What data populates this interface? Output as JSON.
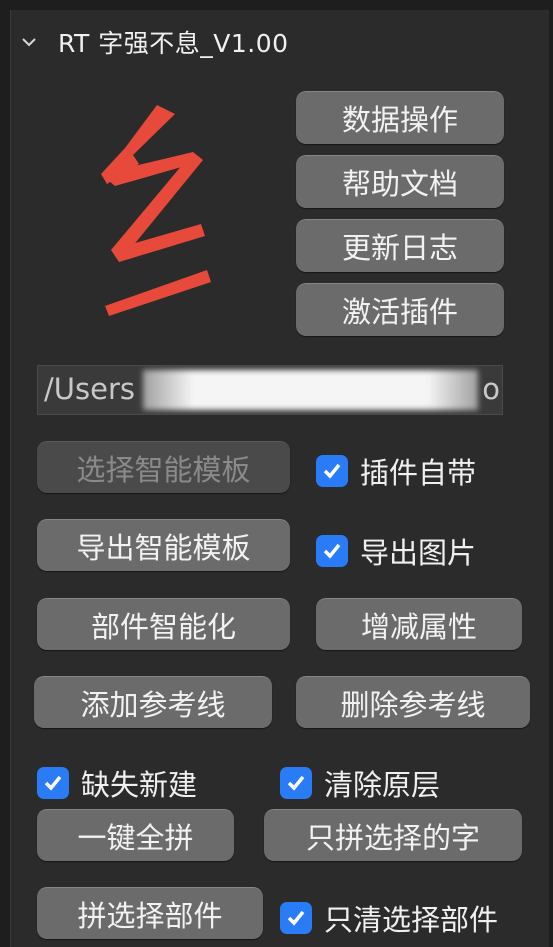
{
  "panel": {
    "title": "RT 字强不息_V1.00"
  },
  "logo": {
    "color": "#e7493b"
  },
  "side_buttons": [
    "数据操作",
    "帮助文档",
    "更新日志",
    "激活插件"
  ],
  "path_field": {
    "prefix": "/Users",
    "suffix": "o"
  },
  "buttons": {
    "select_template": "选择智能模板",
    "export_template": "导出智能模板",
    "componentize": "部件智能化",
    "edit_attributes": "增减属性",
    "add_guides": "添加参考线",
    "delete_guides": "删除参考线",
    "one_click_assemble": "一键全拼",
    "assemble_selected_chars": "只拼选择的字",
    "assemble_selected_parts": "拼选择部件"
  },
  "checkboxes": {
    "plugin_builtin": {
      "label": "插件自带",
      "checked": true
    },
    "export_images": {
      "label": "导出图片",
      "checked": true
    },
    "create_missing": {
      "label": "缺失新建",
      "checked": true
    },
    "clear_original_layer": {
      "label": "清除原层",
      "checked": true
    },
    "clear_selected_parts_only": {
      "label": "只清选择部件",
      "checked": true
    }
  },
  "colors": {
    "accent": "#2a7cf6",
    "button": "#6b6b6b",
    "panel": "#2b2b2b"
  }
}
